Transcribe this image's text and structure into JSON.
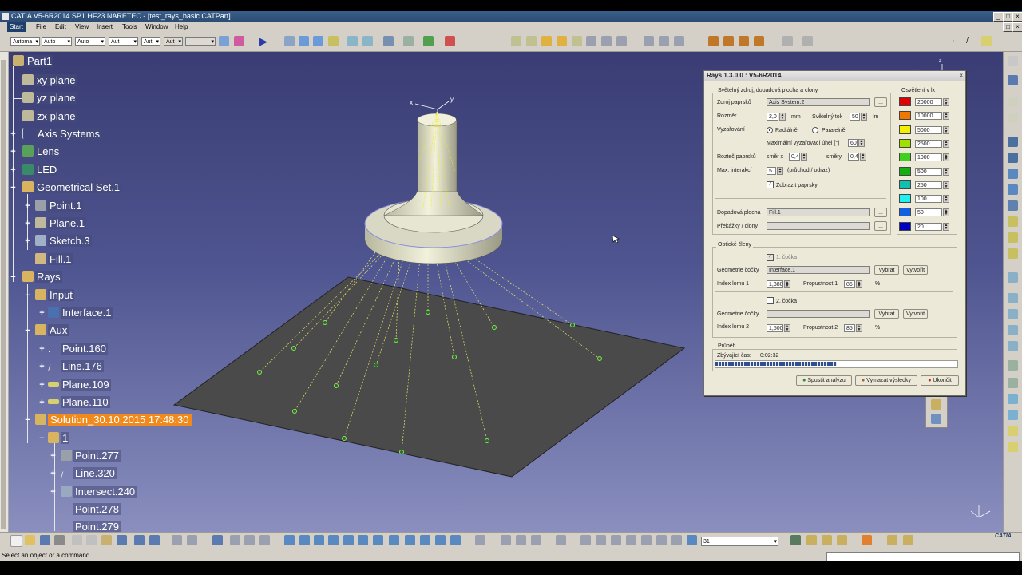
{
  "window": {
    "title": "CATIA V5-6R2014 SP1 HF23 NARETEC - [test_rays_basic.CATPart]"
  },
  "menu": {
    "items": [
      "Start",
      "File",
      "Edit",
      "View",
      "Insert",
      "Tools",
      "Window",
      "Help"
    ]
  },
  "toolbar_selects": [
    "Automa",
    "Auto",
    "Auto",
    "Aut",
    "Aut",
    ""
  ],
  "tree": {
    "root": "Part1",
    "nodes": [
      {
        "label": "xy plane",
        "icon": "plane-icon"
      },
      {
        "label": "yz plane",
        "icon": "plane-icon"
      },
      {
        "label": "zx plane",
        "icon": "plane-icon"
      },
      {
        "label": "Axis Systems",
        "icon": "axis-system-icon"
      },
      {
        "label": "Lens",
        "icon": "body-icon"
      },
      {
        "label": "LED",
        "icon": "body-icon"
      },
      {
        "label": "Geometrical Set.1",
        "icon": "geometrical-set-icon"
      },
      {
        "label": "Point.1",
        "icon": "point-icon"
      },
      {
        "label": "Plane.1",
        "icon": "plane-icon"
      },
      {
        "label": "Sketch.3",
        "icon": "sketch-icon"
      },
      {
        "label": "Fill.1",
        "icon": "fill-icon"
      },
      {
        "label": "Rays",
        "icon": "geometrical-set-icon"
      },
      {
        "label": "Input",
        "icon": "geometrical-set-icon"
      },
      {
        "label": "Interface.1",
        "icon": "interface-icon"
      },
      {
        "label": "Aux",
        "icon": "geometrical-set-icon"
      },
      {
        "label": "Point.160",
        "icon": "point-icon"
      },
      {
        "label": "Line.176",
        "icon": "line-icon"
      },
      {
        "label": "Plane.109",
        "icon": "plane-icon"
      },
      {
        "label": "Plane.110",
        "icon": "plane-icon"
      },
      {
        "label": "Solution_30.10.2015 17:48:30",
        "icon": "geometrical-set-icon"
      },
      {
        "label": "1",
        "icon": "geometrical-set-icon"
      },
      {
        "label": "Point.277",
        "icon": "point-icon"
      },
      {
        "label": "Line.320",
        "icon": "line-icon"
      },
      {
        "label": "Intersect.240",
        "icon": "intersect-icon"
      },
      {
        "label": "Point.278",
        "icon": "point-icon"
      },
      {
        "label": "Point.279",
        "icon": "point-icon"
      }
    ]
  },
  "dialog": {
    "title": "Rays 1.3.0.0 : V5-6R2014",
    "source_group": "Světelný zdroj, dopadová plocha a clony",
    "source_label": "Zdroj paprsků",
    "source_value": "Axis System.2",
    "size_label": "Rozměr",
    "size_value": "2,0",
    "size_unit": "mm",
    "flux_label": "Světelný tok",
    "flux_value": "50",
    "flux_unit": "lm",
    "emit_label": "Vyzařování",
    "radial_label": "Radiálně",
    "parallel_label": "Paralelně",
    "max_angle_label": "Maximální vyzařovací úhel [°]",
    "max_angle_value": "60",
    "spacing_label": "Rozteč paprsků",
    "spacing_x_label": "směr x",
    "spacing_x_value": "0,4",
    "spacing_y_label": "směry",
    "spacing_y_value": "0,4",
    "max_inter_label": "Max. interakcí",
    "max_inter_value": "5",
    "max_inter_hint": "(průchod / odraz)",
    "show_rays_label": "Zobrazit paprsky",
    "target_label": "Dopadová plocha",
    "target_value": "Fill.1",
    "obstacles_label": "Překážky / clony",
    "obstacles_value": "",
    "browse_label": "...",
    "optics_group": "Optické členy",
    "lens1_label": "1. čočka",
    "lens_geom_label": "Geometrie čočky",
    "lens1_geom_value": "Interface.1",
    "select_label": "Vybrat",
    "create_label": "Vytvořit",
    "index1_label": "Index lomu 1",
    "index1_value": "1,380",
    "trans1_label": "Propustnost 1",
    "trans1_value": "85",
    "percent": "%",
    "lens2_label": "2. čočka",
    "lens2_geom_value": "",
    "index2_label": "Index lomu 2",
    "index2_value": "1,500",
    "trans2_label": "Propustnost 2",
    "trans2_value": "85",
    "progress_group": "Průběh",
    "remaining_label": "Zbývající čas:",
    "remaining_value": "0:02:32",
    "progress_fraction": 0.5,
    "run_label": "Spustit analýzu",
    "clear_label": "Vymazat výsledky",
    "close_label": "Ukončit",
    "illum_group": "Osvětlení v lx",
    "illum_levels": [
      {
        "color": "#e00000",
        "value": "20000"
      },
      {
        "color": "#f07800",
        "value": "10000"
      },
      {
        "color": "#f0f000",
        "value": "5000"
      },
      {
        "color": "#a0e000",
        "value": "2500"
      },
      {
        "color": "#40d020",
        "value": "1000"
      },
      {
        "color": "#10b010",
        "value": "500"
      },
      {
        "color": "#10c0b0",
        "value": "250"
      },
      {
        "color": "#20f0f0",
        "value": "100"
      },
      {
        "color": "#1060e0",
        "value": "50"
      },
      {
        "color": "#0000c0",
        "value": "20"
      }
    ]
  },
  "combo_value": "31",
  "status": "Select an object or a command",
  "brand": "CATIA"
}
